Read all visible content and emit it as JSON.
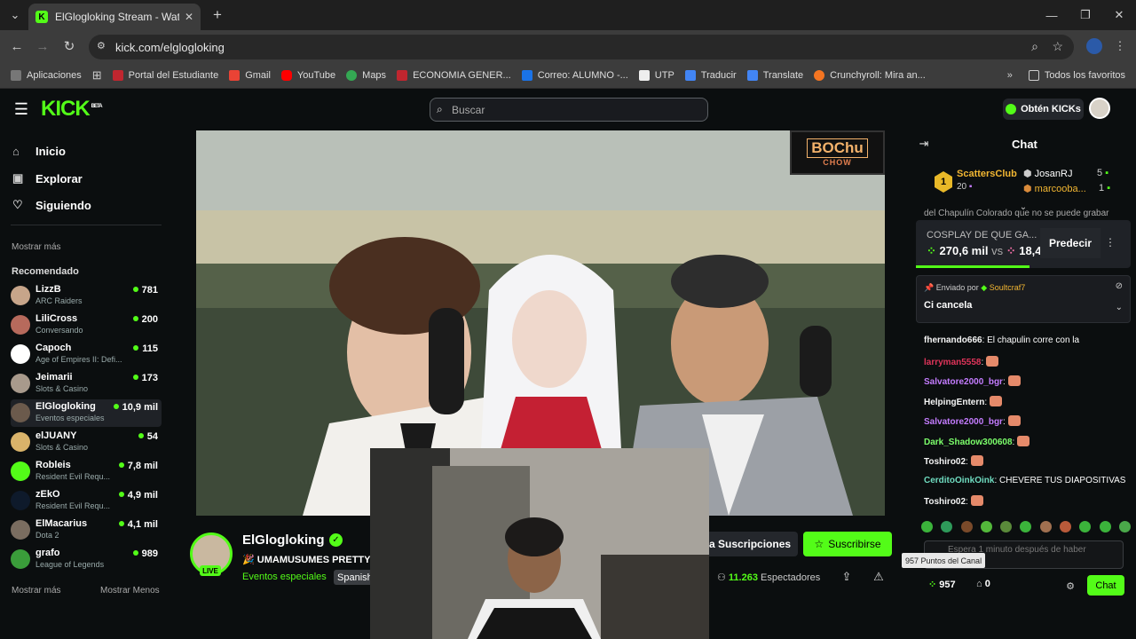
{
  "browser": {
    "tab_title": "ElGlogloking Stream - Watch Li...",
    "url": "kick.com/elglogloking",
    "bookmarks": [
      "Aplicaciones",
      "Portal del Estudiante",
      "Gmail",
      "YouTube",
      "Maps",
      "ECONOMIA GENER...",
      "Correo: ALUMNO -...",
      "UTP",
      "Traducir",
      "Translate",
      "Crunchyroll: Mira an..."
    ],
    "all_bookmarks": "Todos los favoritos"
  },
  "header": {
    "logo": "KICK",
    "logo_badge": "BETA",
    "search_placeholder": "Buscar",
    "kicks_button": "Obtén KICKs"
  },
  "sidebar": {
    "nav": [
      "Inicio",
      "Explorar",
      "Siguiendo"
    ],
    "show_more_top": "Mostrar más",
    "recommended_title": "Recomendado",
    "channels": [
      {
        "name": "LizzB",
        "category": "ARC Raiders",
        "viewers": "781",
        "color": "#c7a58a"
      },
      {
        "name": "LiliCross",
        "category": "Conversando",
        "viewers": "200",
        "color": "#b76a5c"
      },
      {
        "name": "Capoch",
        "category": "Age of Empires II: Defi...",
        "viewers": "115",
        "color": "#ffffff"
      },
      {
        "name": "Jeimarii",
        "category": "Slots & Casino",
        "viewers": "173",
        "color": "#a89a8c"
      },
      {
        "name": "ElGlogloking",
        "category": "Eventos especiales",
        "viewers": "10,9 mil",
        "color": "#6b5a4c"
      },
      {
        "name": "elJUANY",
        "category": "Slots & Casino",
        "viewers": "54",
        "color": "#d9b36a"
      },
      {
        "name": "Robleis",
        "category": "Resident Evil Requ...",
        "viewers": "7,8 mil",
        "color": "#53fc18"
      },
      {
        "name": "zEkO",
        "category": "Resident Evil Requ...",
        "viewers": "4,9 mil",
        "color": "#0e1a2b"
      },
      {
        "name": "ElMacarius",
        "category": "Dota 2",
        "viewers": "4,1 mil",
        "color": "#7a6d60"
      },
      {
        "name": "grafo",
        "category": "League of Legends",
        "viewers": "989",
        "color": "#3a9d3a"
      }
    ],
    "show_more": "Mostrar más",
    "show_less": "Mostrar Menos"
  },
  "overlay": {
    "brand_line1": "BOChu",
    "brand_line2": "CHOW"
  },
  "stream": {
    "channel": "ElGlogloking",
    "live_badge": "LIVE",
    "title": "UMAMUSUMES PRETTY",
    "category": "Eventos especiales",
    "language": "Spanish",
    "subs_button": "a Suscripciones",
    "subscribe_button": "Suscribirse",
    "viewers": "11.263",
    "viewers_label": "Espectadores"
  },
  "chat": {
    "title": "Chat",
    "leaderboard": {
      "first": {
        "name": "ScattersClub",
        "count": "20"
      },
      "second": {
        "name": "JosanRJ",
        "count": "5"
      },
      "third": {
        "name": "marcooba...",
        "count": "1"
      }
    },
    "truncated_line": "del Chapulín Colorado que no se puede grabar",
    "prediction": {
      "label": "COSPLAY DE QUE GA...",
      "left": "270,6 mil",
      "vs": "vs",
      "right": "18,4",
      "button": "Predecir"
    },
    "pinned": {
      "sent_by": "Enviado por",
      "user": "Soultcraf7",
      "text": "Ci cancela"
    },
    "messages": [
      {
        "user": "fhernando666",
        "text": "El chapulin corre con la",
        "color": "#f5f5f5"
      },
      {
        "user": "larryman5558",
        "text": "",
        "color": "#e0345a"
      },
      {
        "user": "Salvatore2000_bgr",
        "text": "",
        "color": "#c47cff"
      },
      {
        "user": "HelpingEntern",
        "text": "",
        "color": "#f5f5f5"
      },
      {
        "user": "Salvatore2000_bgr",
        "text": "",
        "color": "#c47cff"
      },
      {
        "user": "Dark_Shadow300608",
        "text": "",
        "color": "#7cff6b"
      },
      {
        "user": "Toshiro02",
        "text": "",
        "color": "#f5f5f5"
      },
      {
        "user": "CerditoOinkOink",
        "text": "CHEVERE TUS DIAPOSITIVAS",
        "color": "#6fdcc0"
      },
      {
        "user": "Toshiro02",
        "text": "",
        "color": "#f5f5f5"
      }
    ],
    "input_placeholder": "Espera 1 minuto después de haber",
    "tooltip": "957 Puntos del Canal",
    "points": "957",
    "tickets": "0",
    "chat_button": "Chat"
  },
  "colors": {
    "accent": "#53fc18",
    "bg": "#0b0e0f"
  }
}
